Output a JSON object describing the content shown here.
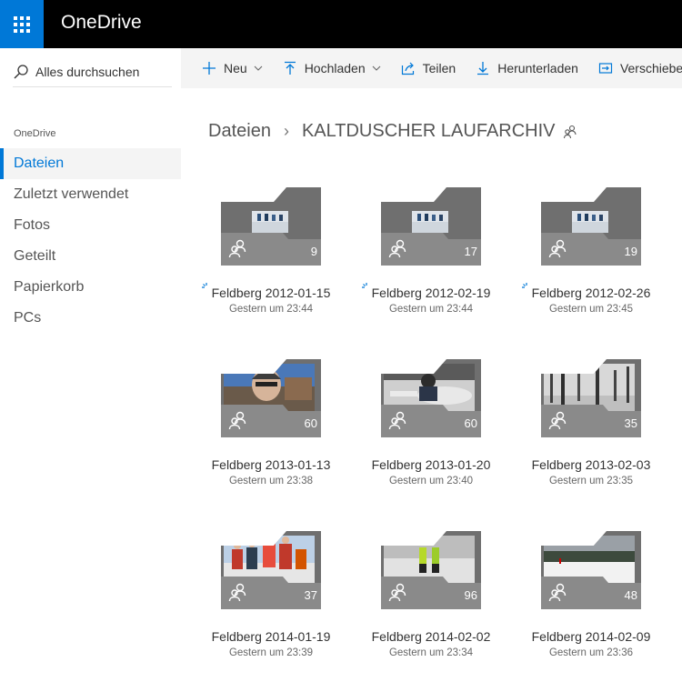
{
  "app": {
    "title": "OneDrive"
  },
  "search": {
    "placeholder": "Alles durchsuchen"
  },
  "sidebar": {
    "heading": "OneDrive",
    "items": [
      {
        "label": "Dateien",
        "active": true
      },
      {
        "label": "Zuletzt verwendet"
      },
      {
        "label": "Fotos"
      },
      {
        "label": "Geteilt"
      },
      {
        "label": "Papierkorb"
      },
      {
        "label": "PCs"
      }
    ]
  },
  "commands": {
    "new": "Neu",
    "upload": "Hochladen",
    "share": "Teilen",
    "download": "Herunterladen",
    "move": "Verschieben nach"
  },
  "breadcrumb": {
    "root": "Dateien",
    "current": "KALTDUSCHER LAUFARCHIV"
  },
  "folders": [
    {
      "name": "Feldberg 2012-01-15",
      "modified": "Gestern um 23:44",
      "count": "9",
      "new": true,
      "thumb": "small"
    },
    {
      "name": "Feldberg 2012-02-19",
      "modified": "Gestern um 23:44",
      "count": "17",
      "new": true,
      "thumb": "small"
    },
    {
      "name": "Feldberg 2012-02-26",
      "modified": "Gestern um 23:45",
      "count": "19",
      "new": true,
      "thumb": "small"
    },
    {
      "name": "Feldberg 2013-01-13",
      "modified": "Gestern um 23:38",
      "count": "60",
      "new": false,
      "thumb": "face"
    },
    {
      "name": "Feldberg 2013-01-20",
      "modified": "Gestern um 23:40",
      "count": "60",
      "new": false,
      "thumb": "car"
    },
    {
      "name": "Feldberg 2013-02-03",
      "modified": "Gestern um 23:35",
      "count": "35",
      "new": false,
      "thumb": "forest"
    },
    {
      "name": "Feldberg 2014-01-19",
      "modified": "Gestern um 23:39",
      "count": "37",
      "new": false,
      "thumb": "group"
    },
    {
      "name": "Feldberg 2014-02-02",
      "modified": "Gestern um 23:34",
      "count": "96",
      "new": false,
      "thumb": "snow"
    },
    {
      "name": "Feldberg 2014-02-09",
      "modified": "Gestern um 23:36",
      "count": "48",
      "new": false,
      "thumb": "landscape"
    }
  ],
  "colors": {
    "accent": "#0078d7",
    "topbar": "#000000",
    "folder": "#8a8a8a",
    "folder_dark": "#6f6f6f"
  }
}
